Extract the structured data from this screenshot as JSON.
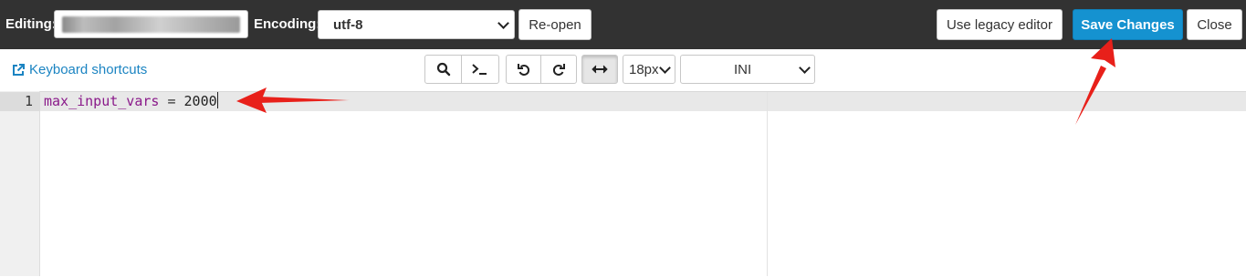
{
  "header": {
    "editing_label": "Editing:",
    "encoding_label": "Encoding:",
    "encoding_value": "utf-8",
    "reopen_label": "Re-open",
    "legacy_label": "Use legacy editor",
    "save_label": "Save Changes",
    "close_label": "Close"
  },
  "toolbar": {
    "shortcuts_label": "Keyboard shortcuts",
    "font_size": "18px",
    "mode": "INI"
  },
  "editor": {
    "line_number": "1",
    "key": "max_input_vars",
    "operator": " = ",
    "value": "2000"
  },
  "colors": {
    "topbar": "#323232",
    "accent": "#1592d0",
    "annotation": "#e8201a"
  }
}
